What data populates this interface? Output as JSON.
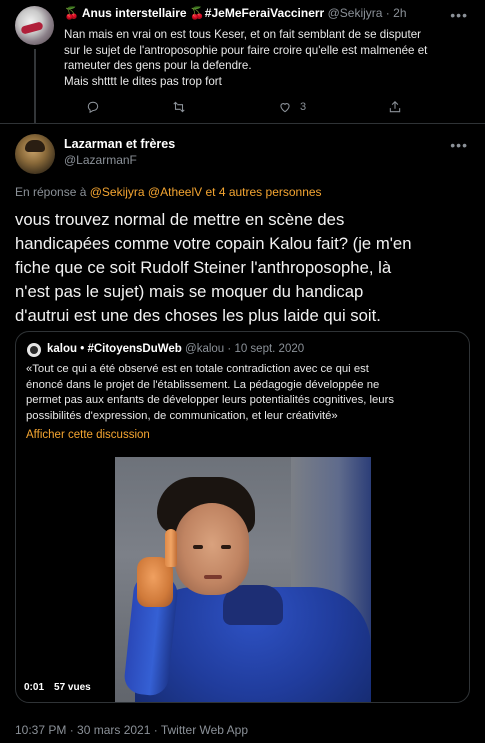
{
  "reply_tweet": {
    "name": "🍒 Anus interstellaire 🍒#JeMeFeraiVaccinerr",
    "handle": "@Sekijyra",
    "separator": "·",
    "time": "2h",
    "text_lines": [
      "Nan mais en vrai on est tous Keser, et on fait semblant de se disputer",
      "sur le sujet de l'antroposophie pour faire croire qu'elle est malmenée et",
      "rameuter des gens pour la defendre.",
      "Mais shtttt le dites pas trop fort"
    ],
    "like_count": "3",
    "icons": [
      "reply-icon",
      "retweet-icon",
      "like-icon",
      "share-icon"
    ]
  },
  "main_tweet": {
    "name": "Lazarman et frères",
    "handle": "@LazarmanF",
    "replying_prefix": "En réponse à",
    "replying_mentions": "@Sekijyra @AtheelV",
    "replying_suffix": "et 4 autres personnes",
    "text_lines": [
      "vous trouvez normal de mettre en scène des",
      "handicapées comme votre copain Kalou fait? (je m'en",
      "fiche que ce soit Rudolf Steiner l'anthroposophe, là",
      "n'est pas le sujet) mais se moquer du handicap",
      "d'autrui est une des choses les plus laide qui soit."
    ]
  },
  "quoted_tweet": {
    "name": "kalou • #CitoyensDuWeb",
    "handle": "@kalou",
    "separator": "·",
    "date": "10 sept. 2020",
    "text_lines": [
      "«Tout ce qui a été observé est en totale contradiction avec ce qui est",
      "énoncé dans le projet de l'établissement. La pédagogie développée ne",
      "permet pas aux enfants de développer leurs potentialités cognitives, leurs",
      "possibilités d'expression, de communication, et leur créativité»"
    ],
    "show_thread": "Afficher cette discussion",
    "video_time": "0:01",
    "video_views": "57 vues"
  },
  "footer": "10:37 PM · 30 mars 2021 · Twitter Web App",
  "colors": {
    "accent": "#f4a531",
    "secondary_text": "#8b9198",
    "background": "#000000",
    "border": "#2f3336"
  }
}
